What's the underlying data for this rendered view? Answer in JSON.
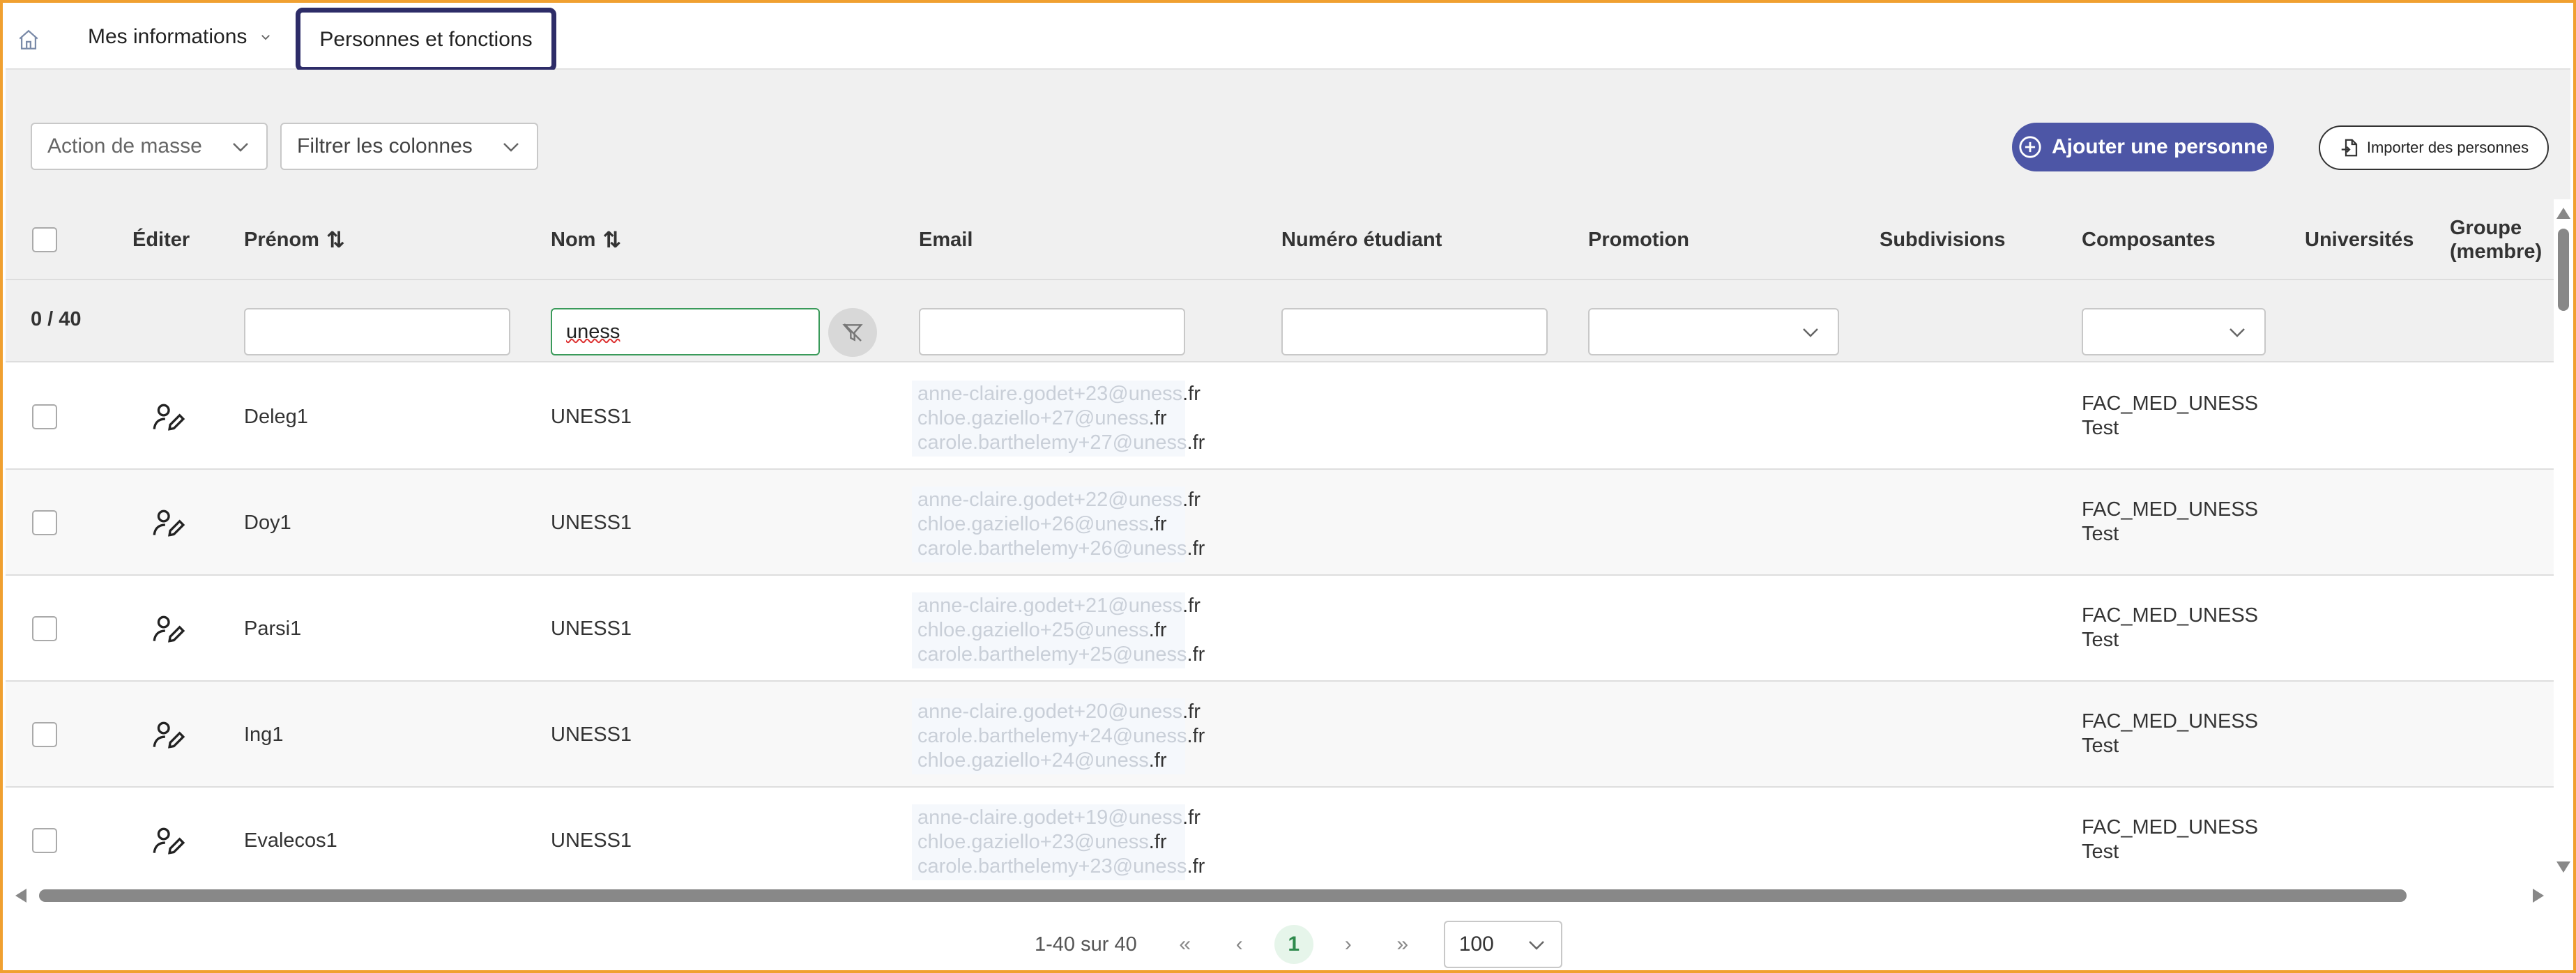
{
  "nav": {
    "home_icon": "home-icon",
    "mes_informations": "Mes informations",
    "personnes_fonctions": "Personnes et fonctions"
  },
  "toolbar": {
    "mass_action": "Action de masse",
    "filter_columns": "Filtrer les colonnes",
    "add_person": "Ajouter une personne",
    "import_persons": "Importer des personnes"
  },
  "table": {
    "headers": {
      "edit": "Éditer",
      "firstname": "Prénom",
      "lastname": "Nom",
      "email": "Email",
      "student_number": "Numéro étudiant",
      "promotion": "Promotion",
      "subdivisions": "Subdivisions",
      "components": "Composantes",
      "universities": "Universités",
      "group_line1": "Groupe",
      "group_line2": "(membre)"
    },
    "selection_count": "0 / 40",
    "filters": {
      "lastname_value": "uness"
    },
    "rows": [
      {
        "firstname": "Deleg1",
        "lastname": "UNESS1",
        "emails": [
          "anne-claire.godet+23@uness.fr",
          "chloe.gaziello+27@uness.fr",
          "carole.barthelemy+27@uness.fr"
        ],
        "components": [
          "FAC_MED_UNESS",
          "Test"
        ]
      },
      {
        "firstname": "Doy1",
        "lastname": "UNESS1",
        "emails": [
          "anne-claire.godet+22@uness.fr",
          "chloe.gaziello+26@uness.fr",
          "carole.barthelemy+26@uness.fr"
        ],
        "components": [
          "FAC_MED_UNESS",
          "Test"
        ]
      },
      {
        "firstname": "Parsi1",
        "lastname": "UNESS1",
        "emails": [
          "anne-claire.godet+21@uness.fr",
          "chloe.gaziello+25@uness.fr",
          "carole.barthelemy+25@uness.fr"
        ],
        "components": [
          "FAC_MED_UNESS",
          "Test"
        ]
      },
      {
        "firstname": "Ing1",
        "lastname": "UNESS1",
        "emails": [
          "anne-claire.godet+20@uness.fr",
          "carole.barthelemy+24@uness.fr",
          "chloe.gaziello+24@uness.fr"
        ],
        "components": [
          "FAC_MED_UNESS",
          "Test"
        ]
      },
      {
        "firstname": "Evalecos1",
        "lastname": "UNESS1",
        "emails": [
          "anne-claire.godet+19@uness.fr",
          "chloe.gaziello+23@uness.fr",
          "carole.barthelemy+23@uness.fr"
        ],
        "components": [
          "FAC_MED_UNESS",
          "Test"
        ]
      }
    ]
  },
  "pagination": {
    "range": "1-40 sur 40",
    "first": "«",
    "prev": "‹",
    "current": "1",
    "next": "›",
    "last": "»",
    "page_size": "100"
  },
  "colors": {
    "accent": "#4d56a6",
    "active_tab_border": "#2d2c68",
    "frame": "#f0a030",
    "page_current": "#2e8a4c"
  }
}
